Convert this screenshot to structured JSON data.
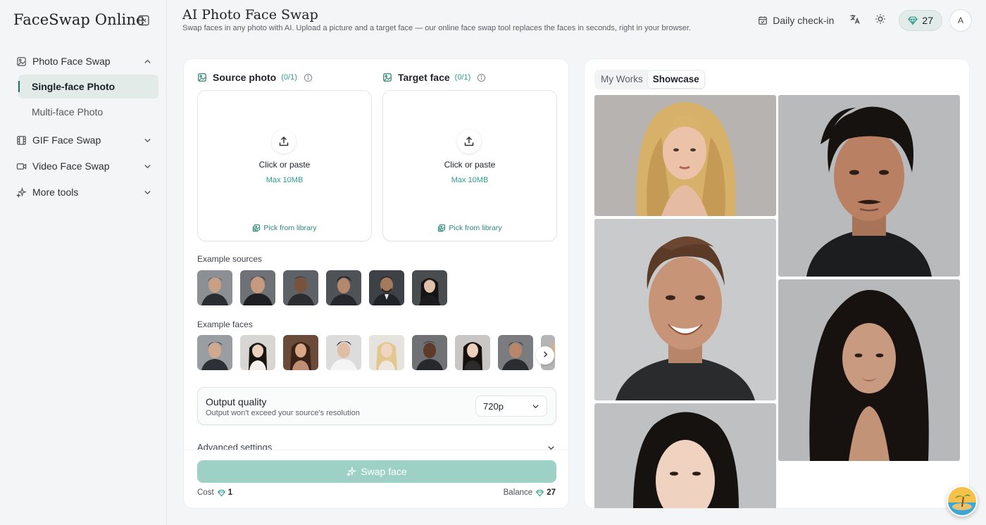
{
  "app": {
    "brand": "FaceSwap Online"
  },
  "sidebar": {
    "items": [
      {
        "label": "Photo Face Swap",
        "expanded": true
      },
      {
        "label": "Single-face Photo",
        "active": true
      },
      {
        "label": "Multi-face Photo"
      },
      {
        "label": "GIF Face Swap"
      },
      {
        "label": "Video Face Swap"
      },
      {
        "label": "More tools"
      }
    ]
  },
  "header": {
    "title": "AI Photo Face Swap",
    "subtitle": "Swap faces in any photo with AI. Upload a picture and a target face — our online face swap tool replaces the faces in seconds, right in your browser.",
    "checkin_label": "Daily check-in",
    "credits": "27",
    "avatar_initial": "A"
  },
  "upload": {
    "source": {
      "title": "Source photo",
      "count": "(0/1)",
      "cta": "Click or paste",
      "max": "Max 10MB",
      "library": "Pick from library"
    },
    "target": {
      "title": "Target face",
      "count": "(0/1)",
      "cta": "Click or paste",
      "max": "Max 10MB",
      "library": "Pick from library"
    }
  },
  "examples": {
    "sources_label": "Example sources",
    "faces_label": "Example faces"
  },
  "quality": {
    "title": "Output quality",
    "subtitle": "Output won't exceed your source's resolution",
    "selected": "720p"
  },
  "advanced": {
    "label": "Advanced settings"
  },
  "action": {
    "swap_label": "Swap face",
    "cost_label": "Cost",
    "cost_value": "1",
    "balance_label": "Balance",
    "balance_value": "27"
  },
  "gallery": {
    "tabs": [
      {
        "label": "My Works"
      },
      {
        "label": "Showcase",
        "active": true
      }
    ]
  },
  "colors": {
    "accent": "#2a9d8f",
    "button_disabled": "#9ed1c6",
    "active_nav_bg": "#e3ebe9"
  }
}
